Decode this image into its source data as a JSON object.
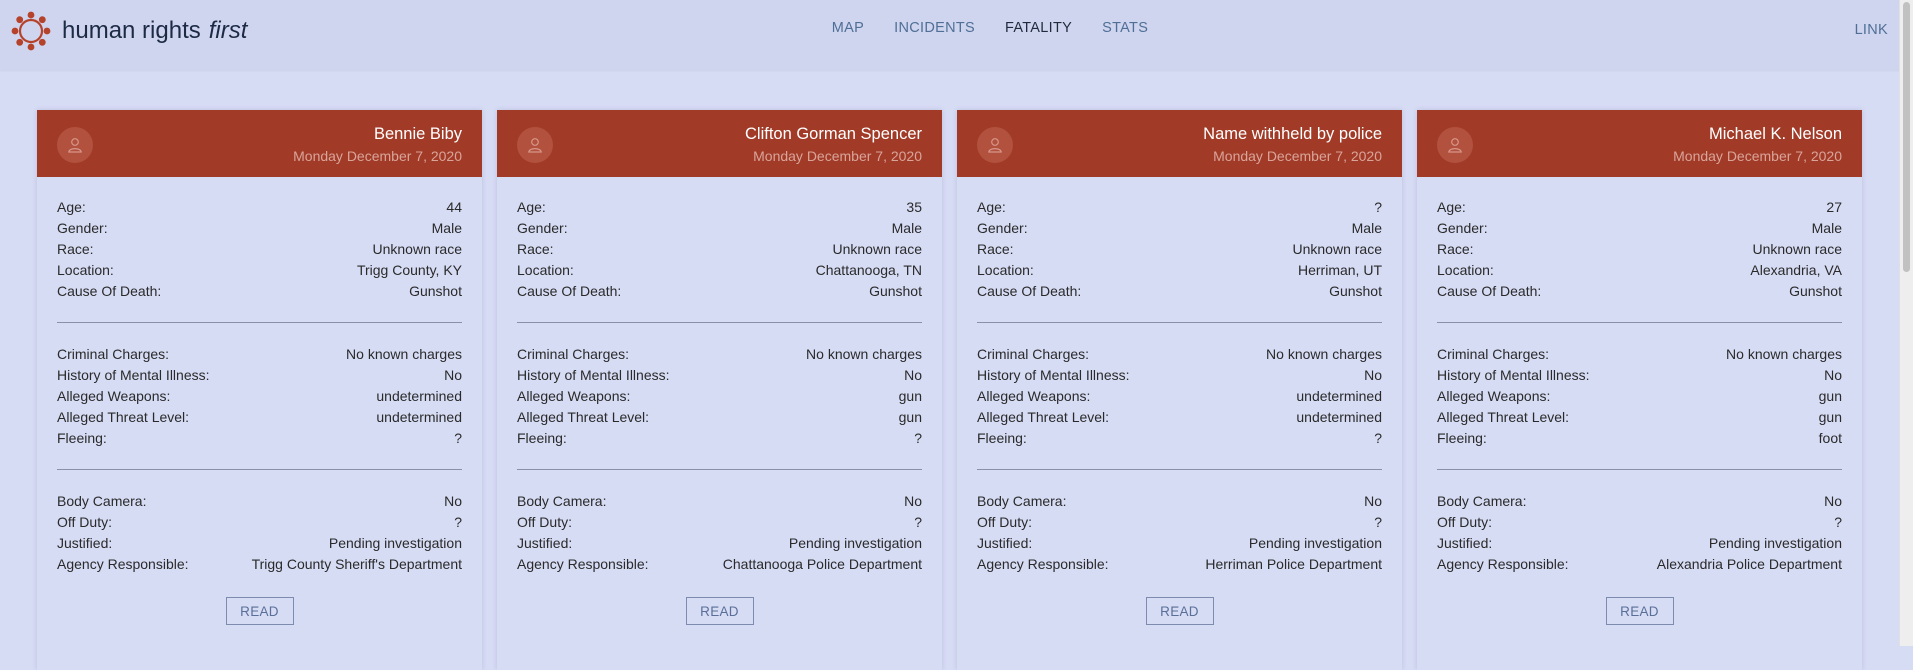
{
  "brand": {
    "name": "human rights",
    "name_em": "first"
  },
  "nav": {
    "items": [
      {
        "label": "MAP",
        "active": false
      },
      {
        "label": "INCIDENTS",
        "active": false
      },
      {
        "label": "FATALITY",
        "active": true
      },
      {
        "label": "STATS",
        "active": false
      }
    ],
    "right_link": "LINK"
  },
  "labels": {
    "age": "Age:",
    "gender": "Gender:",
    "race": "Race:",
    "location": "Location:",
    "cause": "Cause Of Death:",
    "charges": "Criminal Charges:",
    "mental": "History of Mental Illness:",
    "weapons": "Alleged Weapons:",
    "threat": "Alleged Threat Level:",
    "fleeing": "Fleeing:",
    "camera": "Body Camera:",
    "offduty": "Off Duty:",
    "justified": "Justified:",
    "agency": "Agency Responsible:",
    "read": "READ"
  },
  "colors": {
    "header_red": "#a13b28",
    "background": "#d7dcf5",
    "nav_link": "#4f6f96"
  },
  "cards": [
    {
      "name": "Bennie Biby",
      "date": "Monday December 7, 2020",
      "age": "44",
      "gender": "Male",
      "race": "Unknown race",
      "location": "Trigg County, KY",
      "cause": "Gunshot",
      "charges": "No known charges",
      "mental": "No",
      "weapons": "undetermined",
      "threat": "undetermined",
      "fleeing": "?",
      "camera": "No",
      "offduty": "?",
      "justified": "Pending investigation",
      "agency": "Trigg County Sheriff's Department"
    },
    {
      "name": "Clifton Gorman Spencer",
      "date": "Monday December 7, 2020",
      "age": "35",
      "gender": "Male",
      "race": "Unknown race",
      "location": "Chattanooga, TN",
      "cause": "Gunshot",
      "charges": "No known charges",
      "mental": "No",
      "weapons": "gun",
      "threat": "gun",
      "fleeing": "?",
      "camera": "No",
      "offduty": "?",
      "justified": "Pending investigation",
      "agency": "Chattanooga Police Department"
    },
    {
      "name": "Name withheld by police",
      "date": "Monday December 7, 2020",
      "age": "?",
      "gender": "Male",
      "race": "Unknown race",
      "location": "Herriman, UT",
      "cause": "Gunshot",
      "charges": "No known charges",
      "mental": "No",
      "weapons": "undetermined",
      "threat": "undetermined",
      "fleeing": "?",
      "camera": "No",
      "offduty": "?",
      "justified": "Pending investigation",
      "agency": "Herriman Police Department"
    },
    {
      "name": "Michael K. Nelson",
      "date": "Monday December 7, 2020",
      "age": "27",
      "gender": "Male",
      "race": "Unknown race",
      "location": "Alexandria, VA",
      "cause": "Gunshot",
      "charges": "No known charges",
      "mental": "No",
      "weapons": "gun",
      "threat": "gun",
      "fleeing": "foot",
      "camera": "No",
      "offduty": "?",
      "justified": "Pending investigation",
      "agency": "Alexandria Police Department"
    }
  ]
}
